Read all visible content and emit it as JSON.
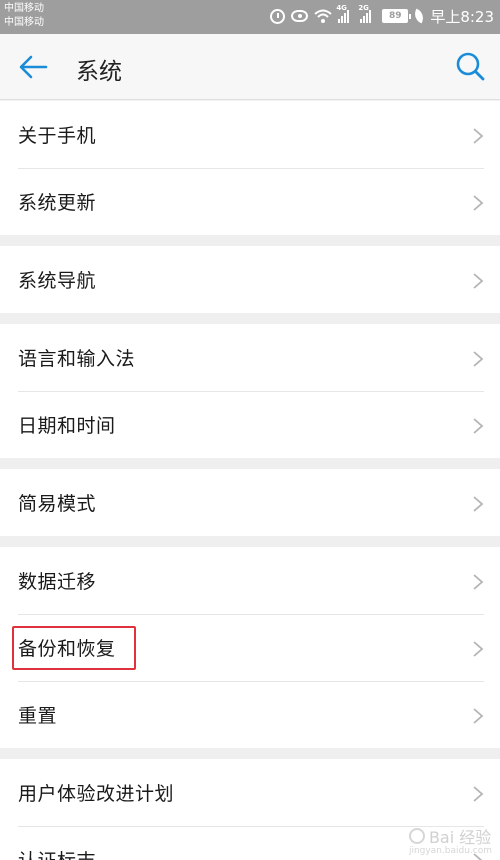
{
  "status_bar": {
    "carrier_1": "中国移动",
    "carrier_2": "中国移动",
    "sig1_tag": "4G",
    "sig2_tag": "2G",
    "battery": "89",
    "time": "早上8:23"
  },
  "header": {
    "title": "系统"
  },
  "groups": [
    {
      "items": [
        "关于手机",
        "系统更新"
      ]
    },
    {
      "items": [
        "系统导航"
      ]
    },
    {
      "items": [
        "语言和输入法",
        "日期和时间"
      ]
    },
    {
      "items": [
        "简易模式"
      ]
    },
    {
      "items": [
        "数据迁移",
        "备份和恢复",
        "重置"
      ]
    },
    {
      "items": [
        "用户体验改进计划",
        "认证标志"
      ]
    }
  ],
  "highlight": {
    "item": "备份和恢复",
    "color": "#e0323c"
  },
  "colors": {
    "accent": "#1a8cd8",
    "status_bar": "#9e9e9e"
  },
  "watermark": {
    "text": "Bai 经验",
    "sub": "jingyan.baidu.com"
  }
}
